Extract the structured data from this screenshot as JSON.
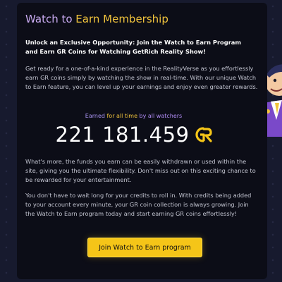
{
  "membership": {
    "title_pre": "Watch to ",
    "title_post": "Earn Membership",
    "lead": "Unlock an Exclusive Opportunity: Join the Watch to Earn Program and Earn GR Coins for Watching GetRich Reality Show!",
    "para1": "Get ready for a one-of-a-kind experience in the RealityVerse as you effortlessly earn GR coins simply by watching the show in real-time. With our unique Watch to Earn feature, you can level up your earnings and enjoy even greater rewards.",
    "earned_pre": "Earned ",
    "earned_mid": "for all time ",
    "earned_post": "by all watchers",
    "amount": "221 181.459",
    "currency_icon": "gr-coin-icon",
    "para2": "What's more, the funds you earn can be easily withdrawn or used within the site, giving you the ultimate flexibility. Don't miss out on this exciting chance to be rewarded for your entertainment.",
    "para3": "You don't have to wait long for your credits to roll in. With credits being added to your account every minute, your GR coin collection is always growing. Join the Watch to Earn program today and start earning GR coins effortlessly!",
    "button_label": "Join Watch to Earn program"
  },
  "colors": {
    "page_bg": "#171a2e",
    "card_bg": "#0c0d17",
    "accent_yellow": "#f0c33c",
    "accent_purple": "#b18cf5",
    "button_bg": "#f5c518"
  }
}
